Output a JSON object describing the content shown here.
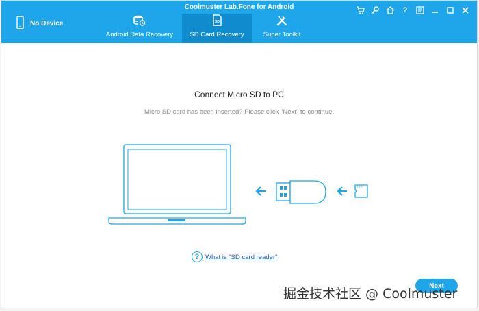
{
  "app": {
    "title": "Coolmuster Lab.Fone for Android"
  },
  "device": {
    "label": "No Device",
    "icon": "phone-icon"
  },
  "tabs": [
    {
      "label": "Android Data Recovery",
      "icon": "database-restore-icon",
      "active": false
    },
    {
      "label": "SD Card Recovery",
      "icon": "sd-card-icon",
      "active": true
    },
    {
      "label": "Super Toolkit",
      "icon": "tools-icon",
      "active": false
    }
  ],
  "window_controls": [
    "cart-icon",
    "key-icon",
    "home-icon",
    "help-icon",
    "feedback-icon",
    "minimize-icon",
    "maximize-icon",
    "close-icon"
  ],
  "main": {
    "heading": "Connect Micro SD to PC",
    "subtext": "Micro SD card has been inserted? Please click \"Next\" to continue.",
    "help_link": "What is \"SD card reader\"",
    "next_button": "Next"
  },
  "watermark": "掘金技术社区 @ Coolmuster",
  "colors": {
    "accent": "#1fa6ea",
    "active_tab": "#0f8ccd",
    "link": "#1a5fb4"
  }
}
